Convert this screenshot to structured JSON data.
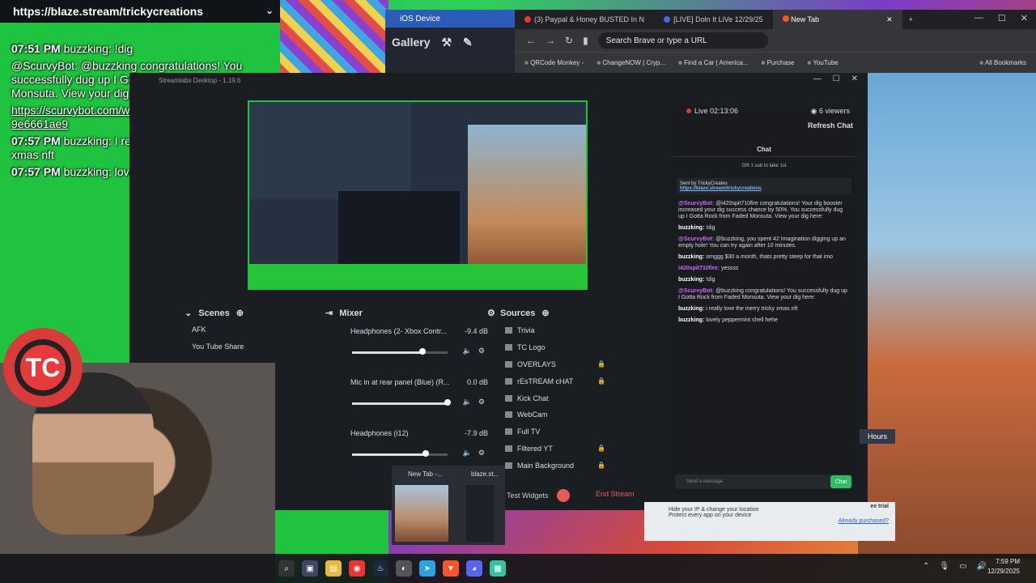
{
  "link_bar": {
    "url": "https://blaze.stream/trickycreations"
  },
  "overlay": {
    "lines": [
      {
        "time": "07:51 PM",
        "text": "buzzking: !dig"
      },
      {
        "time": "",
        "text": "@ScurvyBot: @buzzking congratulations! You successfully dug up I Gotta Rock from Faded Monsuta. View your dig here:"
      },
      {
        "time": "",
        "text": "https://scurvybot.com/wax/tx/bfe6677bce744ef1c388579b8acc51f08c100c218c3ad223884160 9e6661ae9"
      },
      {
        "time": "07:57 PM",
        "text": "buzzking: I really love the merry tricky xmas nft"
      },
      {
        "time": "07:57 PM",
        "text": "buzzking: lovely peppermint shell"
      }
    ]
  },
  "ios_window": {
    "title": "iOS Device",
    "gallery": "Gallery"
  },
  "browser": {
    "tabs": [
      "(3) Paypal & Honey BUSTED In N",
      "[LIVE] Doln It LiVe 12/29/25",
      "New Tab"
    ],
    "address_placeholder": "Search Brave or type a URL",
    "bookmarks": [
      "QRCode Monkey -",
      "ChangeNOW | Cryp...",
      "Find a Car | America...",
      "Purchase",
      "YouTube"
    ],
    "all_bookmarks": "All Bookmarks"
  },
  "streamlabs": {
    "title": "Streamlabs Desktop - 1.19.6",
    "scenes": {
      "header": "Scenes",
      "items": [
        "AFK",
        "You Tube Share"
      ]
    },
    "mixer": {
      "header": "Mixer",
      "channels": [
        {
          "name": "Headphones (2- Xbox Contr...",
          "db": "-9.4 dB",
          "level": 0.74
        },
        {
          "name": "Mic in at rear panel (Blue) (R...",
          "db": "0.0 dB",
          "level": 1.0
        },
        {
          "name": "Headphones (i12)",
          "db": "-7.9 dB",
          "level": 0.77
        }
      ]
    },
    "sources": {
      "header": "Sources",
      "items": [
        "Trivia",
        "TC Logo",
        "OVERLAYS",
        "rEsTREAM cHAT",
        "Kick Chat",
        "WebCam",
        "Full TV",
        "Filtered YT",
        "Main Background"
      ]
    },
    "test_widgets": "Test Widgets",
    "end_stream": "End Stream"
  },
  "chat": {
    "live": "Live 02:13:06",
    "viewers": "6 viewers",
    "refresh": "Refresh Chat",
    "header": "Chat",
    "gift": "Gift 1 sub to take 1st",
    "pinned_by": "Sent by TrickyCreates",
    "pinned_url": "https://blaze.stream/trickycreations",
    "messages": [
      {
        "user": "@ScurvyBot:",
        "text": "@i420spit710fire congratulations! Your dig booster increased your dig success chance by 50%. You successfully dug up I Gotta Rock from Faded Monsuta. View your dig here:"
      },
      {
        "user": "buzzking:",
        "text": "!dig"
      },
      {
        "user": "@ScurvyBot:",
        "text": "@buzzking, you spent 42 Imagination digging up an empty hole! You can try again after 10 minutes."
      },
      {
        "user": "buzzking:",
        "text": "omggg $30 a month, thats pretty steep for that imo"
      },
      {
        "user": "i420spit710fire:",
        "text": "yessss"
      },
      {
        "user": "buzzking:",
        "text": "!dig"
      },
      {
        "user": "@ScurvyBot:",
        "text": "@buzzking congratulations! You successfully dug up I Gotta Rock from Faded Monsuta. View your dig here:"
      },
      {
        "user": "buzzking:",
        "text": "i really love the merry tricky xmas nft"
      },
      {
        "user": "buzzking:",
        "text": "lovely peppermint shell hehe"
      }
    ],
    "input_placeholder": "Send a message",
    "send": "Chat"
  },
  "vpn": {
    "line1": "Hide your IP & change your location",
    "line2": "Protect every app on your device",
    "trial": "ee trial",
    "already": "Already purchased?"
  },
  "hours_badge": "Hours",
  "taskbar_preview": {
    "tab1": "New Tab -...",
    "tab2": "blaze.st..."
  },
  "clock": {
    "time": "7:59 PM",
    "date": "12/29/2025"
  },
  "colors": {
    "accent_green": "#1fc33f",
    "end_stream_red": "#f25a5a",
    "chat_send": "#2dbd63"
  }
}
